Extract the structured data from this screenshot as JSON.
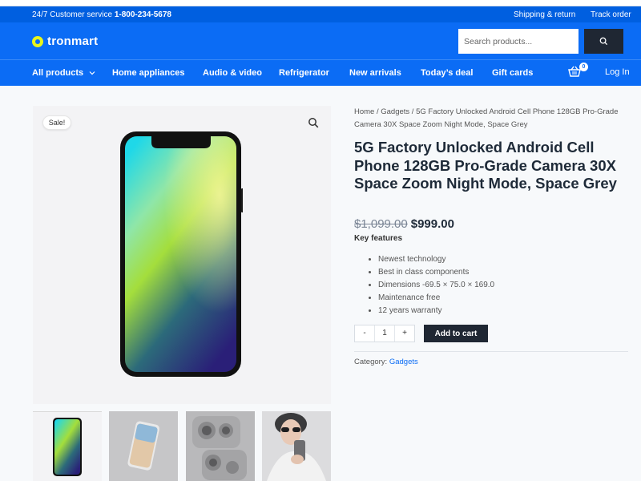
{
  "infobar": {
    "service_label": "24/7 Customer service",
    "phone": "1-800-234-5678",
    "shipping_link": "Shipping & return",
    "track_link": "Track order"
  },
  "header": {
    "logo_text": "tronmart",
    "search_placeholder": "Search products..."
  },
  "nav": {
    "all_products": "All products",
    "items": [
      "Home appliances",
      "Audio & video",
      "Refrigerator",
      "New arrivals",
      "Today’s deal",
      "Gift cards"
    ],
    "cart_count": "0",
    "login": "Log In"
  },
  "gallery": {
    "sale_badge": "Sale!"
  },
  "product": {
    "breadcrumb": "Home / Gadgets / 5G Factory Unlocked Android Cell Phone 128GB Pro-Grade Camera 30X Space Zoom Night Mode, Space Grey",
    "title": "5G Factory Unlocked Android Cell Phone 128GB Pro-Grade Camera 30X Space Zoom Night Mode, Space Grey",
    "old_price": "$1,099.00",
    "price": "$999.00",
    "key_features_label": "Key features",
    "features": [
      "Newest technology",
      "Best in class components",
      "Dimensions -69.5 × 75.0 × 169.0",
      "Maintenance free",
      "12 years warranty"
    ],
    "qty_minus": "-",
    "qty_value": "1",
    "qty_plus": "+",
    "add_to_cart": "Add to cart",
    "category_label": "Category:",
    "category_value": "Gadgets"
  },
  "colors": {
    "primary": "#0b6cf5",
    "dark": "#1f2733",
    "logo_accent": "#e8f51b"
  }
}
